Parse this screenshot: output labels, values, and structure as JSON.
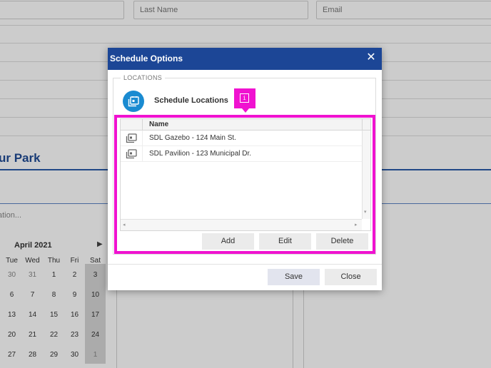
{
  "background": {
    "fields": {
      "last_name_placeholder": "Last Name",
      "email_placeholder": "Email"
    },
    "section_title": "ur Park",
    "location_placeholder": "ation...",
    "calendar": {
      "month": "April 2021",
      "next_icon": "chevron-right-icon",
      "days_of_week": [
        "Tue",
        "Wed",
        "Thu",
        "Fri",
        "Sat"
      ],
      "weeks": [
        [
          "30",
          "31",
          "1",
          "2",
          "3"
        ],
        [
          "6",
          "7",
          "8",
          "9",
          "10"
        ],
        [
          "13",
          "14",
          "15",
          "16",
          "17"
        ],
        [
          "20",
          "21",
          "22",
          "23",
          "24"
        ],
        [
          "27",
          "28",
          "29",
          "30",
          "1"
        ]
      ],
      "first_column_days": [
        "",
        "",
        "",
        "",
        ""
      ]
    }
  },
  "dialog": {
    "title": "Schedule Options",
    "close_glyph": "✕",
    "section_legend": "LOCATIONS",
    "section_label": "Schedule Locations",
    "section_icon": "calendar-location-icon",
    "info_badge_glyph": "i",
    "grid": {
      "column_name": "Name",
      "rows": [
        {
          "name": "SDL Gazebo - 124 Main St.",
          "icon": "location-card-icon"
        },
        {
          "name": "SDL Pavilion - 123 Municipal Dr.",
          "icon": "location-card-icon"
        }
      ],
      "scroll_left": "◂",
      "scroll_right": "▸",
      "scroll_down": "▾"
    },
    "buttons": {
      "add": "Add",
      "edit": "Edit",
      "delete": "Delete",
      "save": "Save",
      "close": "Close"
    }
  },
  "colors": {
    "header_blue": "#1c4696",
    "highlight_magenta": "#f012d0",
    "icon_blue": "#1a8bd1"
  }
}
